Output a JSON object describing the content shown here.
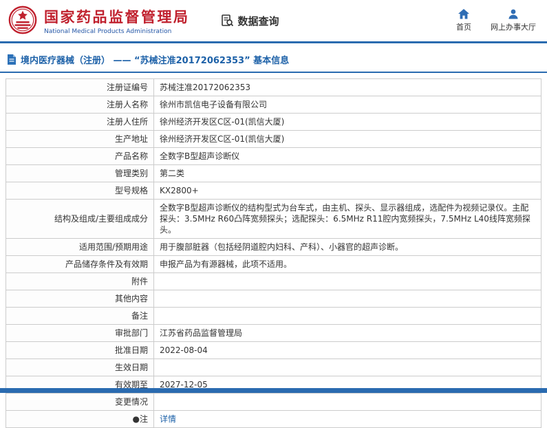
{
  "header": {
    "agency_cn": "国家药品监督管理局",
    "agency_en": "National Medical Products Administration",
    "nav_title": "数据查询",
    "home_label": "首页",
    "hall_label": "网上办事大厅"
  },
  "page": {
    "title": "境内医疗器械（注册） —— “苏械注准20172062353” 基本信息"
  },
  "table": {
    "rows": [
      {
        "label": "注册证编号",
        "value": "苏械注准20172062353"
      },
      {
        "label": "注册人名称",
        "value": "徐州市凯信电子设备有限公司"
      },
      {
        "label": "注册人住所",
        "value": "徐州经济开发区C区-01(凯信大厦)"
      },
      {
        "label": "生产地址",
        "value": "徐州经济开发区C区-01(凯信大厦)"
      },
      {
        "label": "产品名称",
        "value": "全数字B型超声诊断仪"
      },
      {
        "label": "管理类别",
        "value": "第二类"
      },
      {
        "label": "型号规格",
        "value": "KX2800+"
      },
      {
        "label": "结构及组成/主要组成成分",
        "value": "全数字B型超声诊断仪的结构型式为台车式，由主机、探头、显示器组成，选配件为视频记录仪。主配探头：3.5MHz R60凸阵宽频探头；选配探头：6.5MHz R11腔内宽频探头，7.5MHz L40线阵宽频探头。"
      },
      {
        "label": "适用范围/预期用途",
        "value": "用于腹部脏器（包括经阴道腔内妇科、产科）、小器官的超声诊断。"
      },
      {
        "label": "产品储存条件及有效期",
        "value": "申报产品为有源器械，此项不适用。"
      },
      {
        "label": "附件",
        "value": ""
      },
      {
        "label": "其他内容",
        "value": ""
      },
      {
        "label": "备注",
        "value": ""
      },
      {
        "label": "审批部门",
        "value": "江苏省药品监督管理局"
      },
      {
        "label": "批准日期",
        "value": "2022-08-04"
      },
      {
        "label": "生效日期",
        "value": ""
      },
      {
        "label": "有效期至",
        "value": "2027-12-05"
      },
      {
        "label": "变更情况",
        "value": ""
      },
      {
        "label": "●注",
        "value": "详情",
        "link": true
      }
    ]
  },
  "colors": {
    "brand-red": "#c0212e",
    "accent-blue": "#2a6bb0",
    "link-blue": "#1d61a8",
    "en-blue": "#2356a6",
    "border-gray": "#cccccc",
    "text-dark": "#333333"
  }
}
